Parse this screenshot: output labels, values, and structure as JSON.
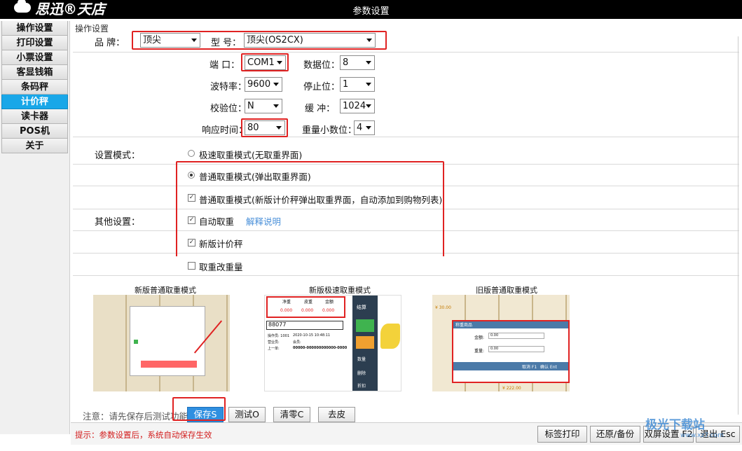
{
  "app": {
    "logo": "思迅®天店",
    "window_title": "参数设置"
  },
  "sidebar": {
    "items": [
      {
        "label": "操作设置"
      },
      {
        "label": "打印设置"
      },
      {
        "label": "小票设置"
      },
      {
        "label": "客显钱箱"
      },
      {
        "label": "条码秤"
      },
      {
        "label": "计价秤",
        "active": true
      },
      {
        "label": "读卡器"
      },
      {
        "label": "POS机"
      },
      {
        "label": "关于"
      }
    ]
  },
  "section": {
    "label": "操作设置"
  },
  "form": {
    "brand_label": "品 牌：",
    "brand_value": "顶尖",
    "model_label": "型 号：",
    "model_value": "顶尖(OS2CX)",
    "port_label": "端 口：",
    "port_value": "COM1",
    "databits_label": "数据位：",
    "databits_value": "8",
    "baud_label": "波特率：",
    "baud_value": "9600",
    "stopbits_label": "停止位：",
    "stopbits_value": "1",
    "parity_label": "校验位：",
    "parity_value": "N",
    "buffer_label": "缓 冲：",
    "buffer_value": "1024",
    "response_label": "响应时间：",
    "response_value": "80",
    "decimals_label": "重量小数位：",
    "decimals_value": "4"
  },
  "mode": {
    "label": "设置模式：",
    "options": [
      {
        "label": "极速取重模式(无取重界面)",
        "selected": false
      },
      {
        "label": "普通取重模式(弹出取重界面)",
        "selected": true
      }
    ]
  },
  "other": {
    "label": "其他设置：",
    "checks": [
      {
        "label": "普通取重模式(新版计价秤弹出取重界面，自动添加到购物列表)",
        "checked": true
      },
      {
        "label": "自动取重",
        "checked": true,
        "link": "解释说明"
      },
      {
        "label": "新版计价秤",
        "checked": true
      },
      {
        "label": "取重改重量",
        "checked": false
      }
    ]
  },
  "previews": [
    {
      "title": "新版普通取重模式"
    },
    {
      "title": "新版极速取重模式",
      "weight_headers": [
        "净重",
        "皮重",
        "金额"
      ],
      "weight_values": [
        "0.000",
        "0.000",
        "0.000"
      ],
      "input": "88077",
      "settle": "结算",
      "operator": "操作员: 1001",
      "time": "2020-10-15 10:48:11",
      "shop": "营业员:",
      "member": "会员:",
      "last": "上一单:",
      "last_value": "00000-000000000000-0000",
      "btn_qty": "数量",
      "btn_del": "删除",
      "btn_disc": "折扣"
    },
    {
      "title": "旧版普通取重模式",
      "dialog_title": "称重商品",
      "amount_label": "金额:",
      "amount_value": "0.00",
      "weight_label": "重量:",
      "weight_value": "0.00",
      "cancel": "取消 F1",
      "ok": "确认 Ent",
      "price1": "¥ 30.00",
      "price2": "¥ 222.00"
    }
  ],
  "actions": {
    "note": "注意：请先保存后测试功能",
    "save": "保存S",
    "test": "测试O",
    "clear": "清零C",
    "tare": "去皮"
  },
  "status": {
    "hint": "提示：参数设置后，系统自动保存生效",
    "label_print": "标签打印",
    "restore": "还原/备份",
    "dual_screen": "双屏设置 F2",
    "exit": "退出 Esc"
  },
  "watermark": {
    "text": "极光下载站",
    "url": "www.xz7.com"
  },
  "colors": {
    "accent": "#19a7e8",
    "highlight": "#e02222",
    "primary_button": "#2f8fe0"
  }
}
